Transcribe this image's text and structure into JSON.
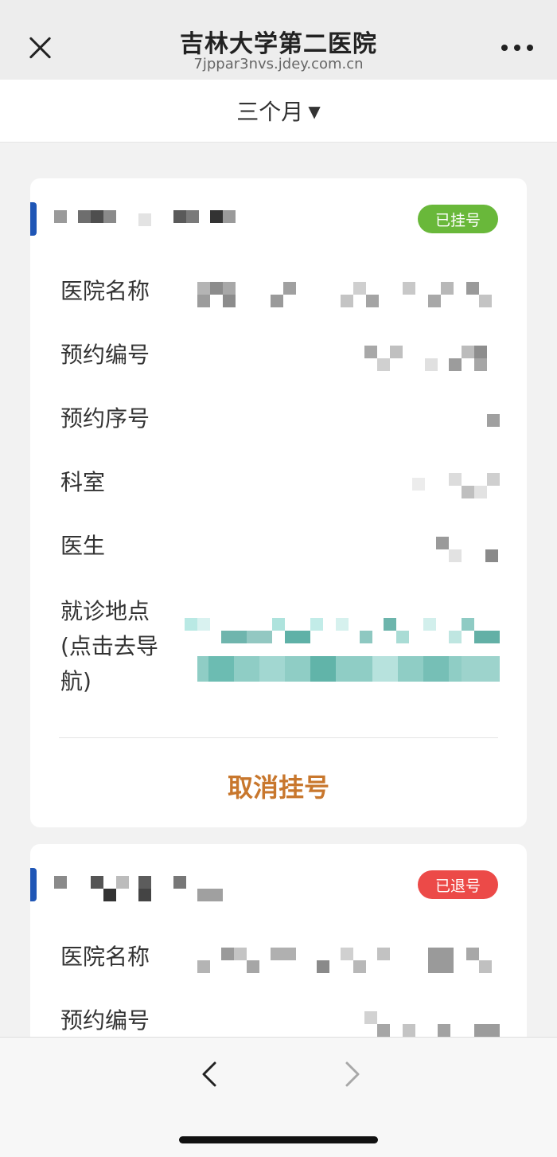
{
  "window": {
    "title": "吉林大学第二医院",
    "url": "7jppar3nvs.jdey.com.cn"
  },
  "filter": {
    "label": "三个月",
    "caret": "▼"
  },
  "records": [
    {
      "status": "已挂号",
      "status_color": "#69b83a",
      "fields": [
        "医院名称",
        "预约编号",
        "预约序号",
        "科室",
        "医生",
        "就诊地点\n(点击去导\n航)"
      ],
      "action": "取消挂号"
    },
    {
      "status": "已退号",
      "status_color": "#ec4a48",
      "fields": [
        "医院名称",
        "预约编号"
      ]
    }
  ],
  "colors": {
    "accent": "#1f56b6",
    "action": "#c8772d",
    "status_booked": "#69b83a",
    "status_cancelled": "#ec4a48"
  },
  "icons": {
    "close": "close-icon",
    "more": "more-icon",
    "back": "chevron-left-icon",
    "forward": "chevron-right-icon"
  }
}
